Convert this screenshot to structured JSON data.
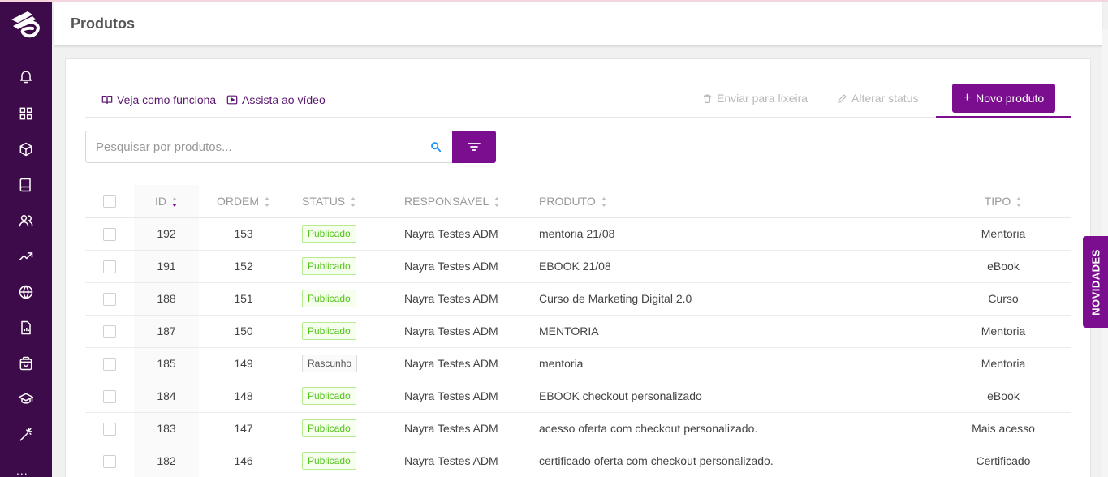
{
  "header": {
    "title": "Produtos"
  },
  "toolbar": {
    "how_it_works": "Veja como funciona",
    "watch_video": "Assista ao vídeo",
    "trash": "Enviar para lixeira",
    "change_status": "Alterar status",
    "new_product": "Novo produto"
  },
  "search": {
    "placeholder": "Pesquisar por produtos..."
  },
  "table": {
    "columns": [
      "ID",
      "ORDEM",
      "STATUS",
      "RESPONSÁVEL",
      "PRODUTO",
      "TIPO"
    ],
    "rows": [
      {
        "id": "192",
        "ordem": "153",
        "status": "Publicado",
        "responsavel": "Nayra Testes ADM",
        "produto": "mentoria 21/08",
        "tipo": "Mentoria"
      },
      {
        "id": "191",
        "ordem": "152",
        "status": "Publicado",
        "responsavel": "Nayra Testes ADM",
        "produto": "EBOOK 21/08",
        "tipo": "eBook"
      },
      {
        "id": "188",
        "ordem": "151",
        "status": "Publicado",
        "responsavel": "Nayra Testes ADM",
        "produto": "Curso de Marketing Digital 2.0",
        "tipo": "Curso"
      },
      {
        "id": "187",
        "ordem": "150",
        "status": "Publicado",
        "responsavel": "Nayra Testes ADM",
        "produto": "MENTORIA",
        "tipo": "Mentoria"
      },
      {
        "id": "185",
        "ordem": "149",
        "status": "Rascunho",
        "responsavel": "Nayra Testes ADM",
        "produto": "mentoria",
        "tipo": "Mentoria"
      },
      {
        "id": "184",
        "ordem": "148",
        "status": "Publicado",
        "responsavel": "Nayra Testes ADM",
        "produto": "EBOOK checkout personalizado",
        "tipo": "eBook"
      },
      {
        "id": "183",
        "ordem": "147",
        "status": "Publicado",
        "responsavel": "Nayra Testes ADM",
        "produto": "acesso oferta com checkout personalizado.",
        "tipo": "Mais acesso"
      },
      {
        "id": "182",
        "ordem": "146",
        "status": "Publicado",
        "responsavel": "Nayra Testes ADM",
        "produto": "certificado oferta com checkout personalizado.",
        "tipo": "Certificado"
      }
    ]
  },
  "sidebar": {
    "items": [
      "bell-icon",
      "grid-icon",
      "box-icon",
      "book-icon",
      "users-icon",
      "trending-icon",
      "globe-icon",
      "report-icon",
      "bag-icon",
      "graduation-icon",
      "magic-wand-icon"
    ],
    "more": "..."
  },
  "novidades": "NOVIDADES",
  "colors": {
    "brand": "#7b0e8f",
    "sidebar": "#3d0a4a",
    "published": "#52c41a"
  }
}
